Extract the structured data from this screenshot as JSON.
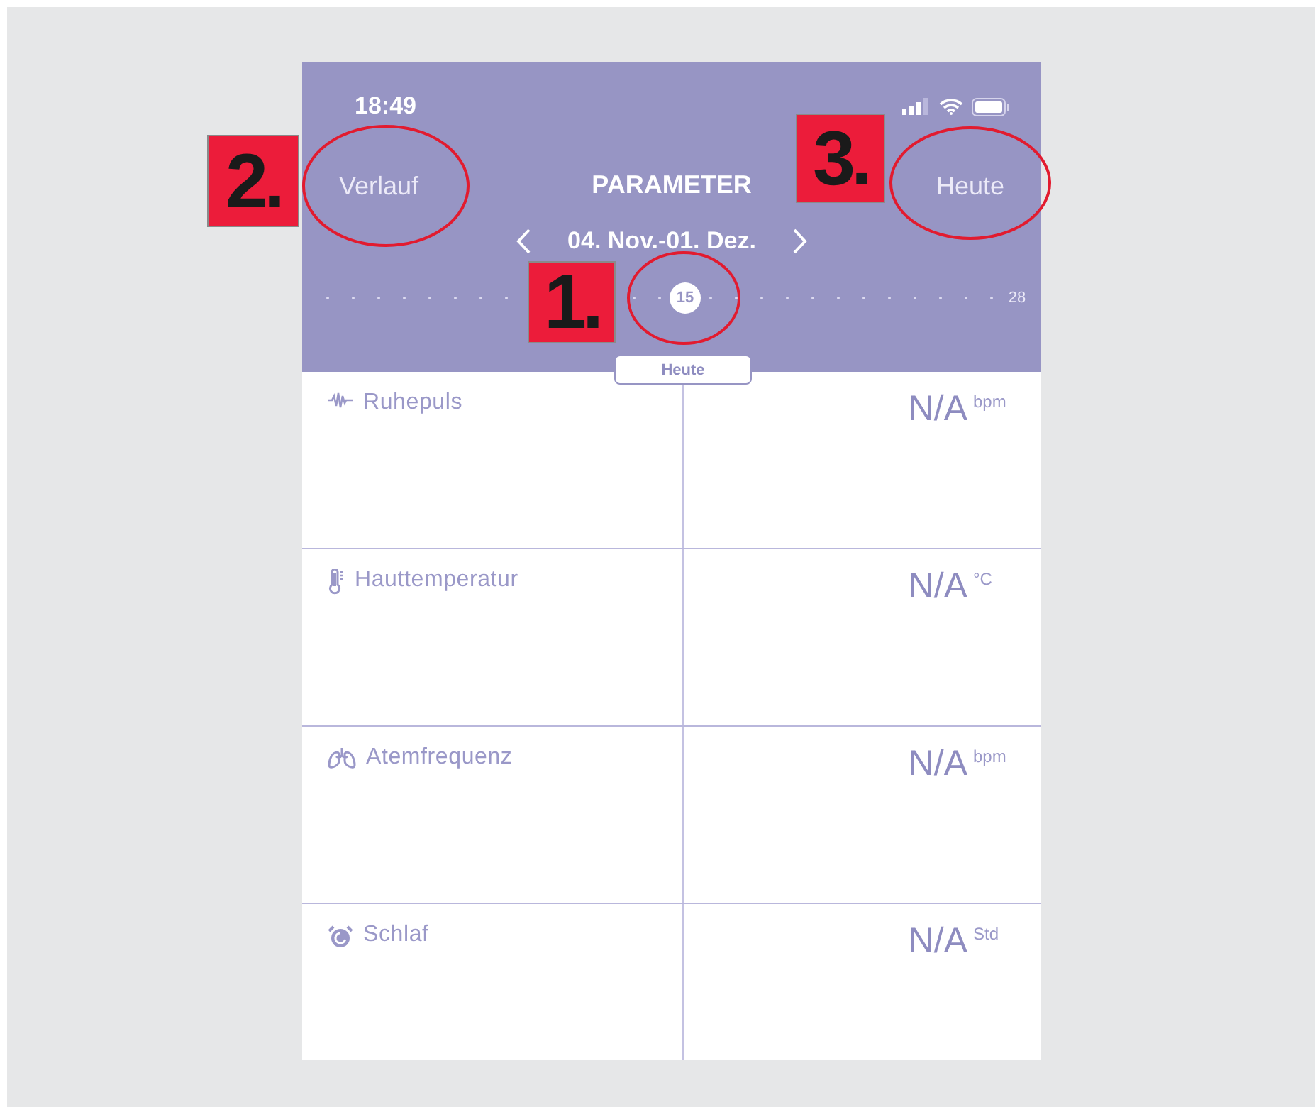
{
  "status_bar": {
    "time": "18:49"
  },
  "header": {
    "left_button": "Verlauf",
    "title": "PARAMETER",
    "right_button": "Heute",
    "date_range": "04. Nov.-01. Dez."
  },
  "timeline": {
    "days": [
      {
        "selected": false
      },
      {
        "selected": false
      },
      {
        "selected": false
      },
      {
        "selected": false
      },
      {
        "selected": false
      },
      {
        "selected": false
      },
      {
        "selected": false
      },
      {
        "selected": false
      },
      {
        "selected": false
      },
      {
        "selected": false
      },
      {
        "selected": false
      },
      {
        "selected": false
      },
      {
        "selected": false
      },
      {
        "selected": false
      },
      {
        "label": "15",
        "selected": true
      },
      {
        "selected": false
      },
      {
        "selected": false
      },
      {
        "selected": false
      },
      {
        "selected": false
      },
      {
        "selected": false
      },
      {
        "selected": false
      },
      {
        "selected": false
      },
      {
        "selected": false
      },
      {
        "selected": false
      },
      {
        "selected": false
      },
      {
        "selected": false
      },
      {
        "selected": false
      },
      {
        "label": "28",
        "selected": false
      }
    ],
    "today_tag": "Heute"
  },
  "metrics": [
    {
      "kind": "pulse",
      "label": "Ruhepuls",
      "value": "N/A",
      "unit": "bpm"
    },
    {
      "kind": "temperature",
      "label": "Hauttemperatur",
      "value": "N/A",
      "unit": "°C"
    },
    {
      "kind": "breathing",
      "label": "Atemfrequenz",
      "value": "N/A",
      "unit": "bpm"
    },
    {
      "kind": "sleep",
      "label": "Schlaf",
      "value": "N/A",
      "unit": "Std"
    }
  ],
  "annotations": [
    {
      "label": "2."
    },
    {
      "label": "3."
    },
    {
      "label": "1."
    }
  ]
}
